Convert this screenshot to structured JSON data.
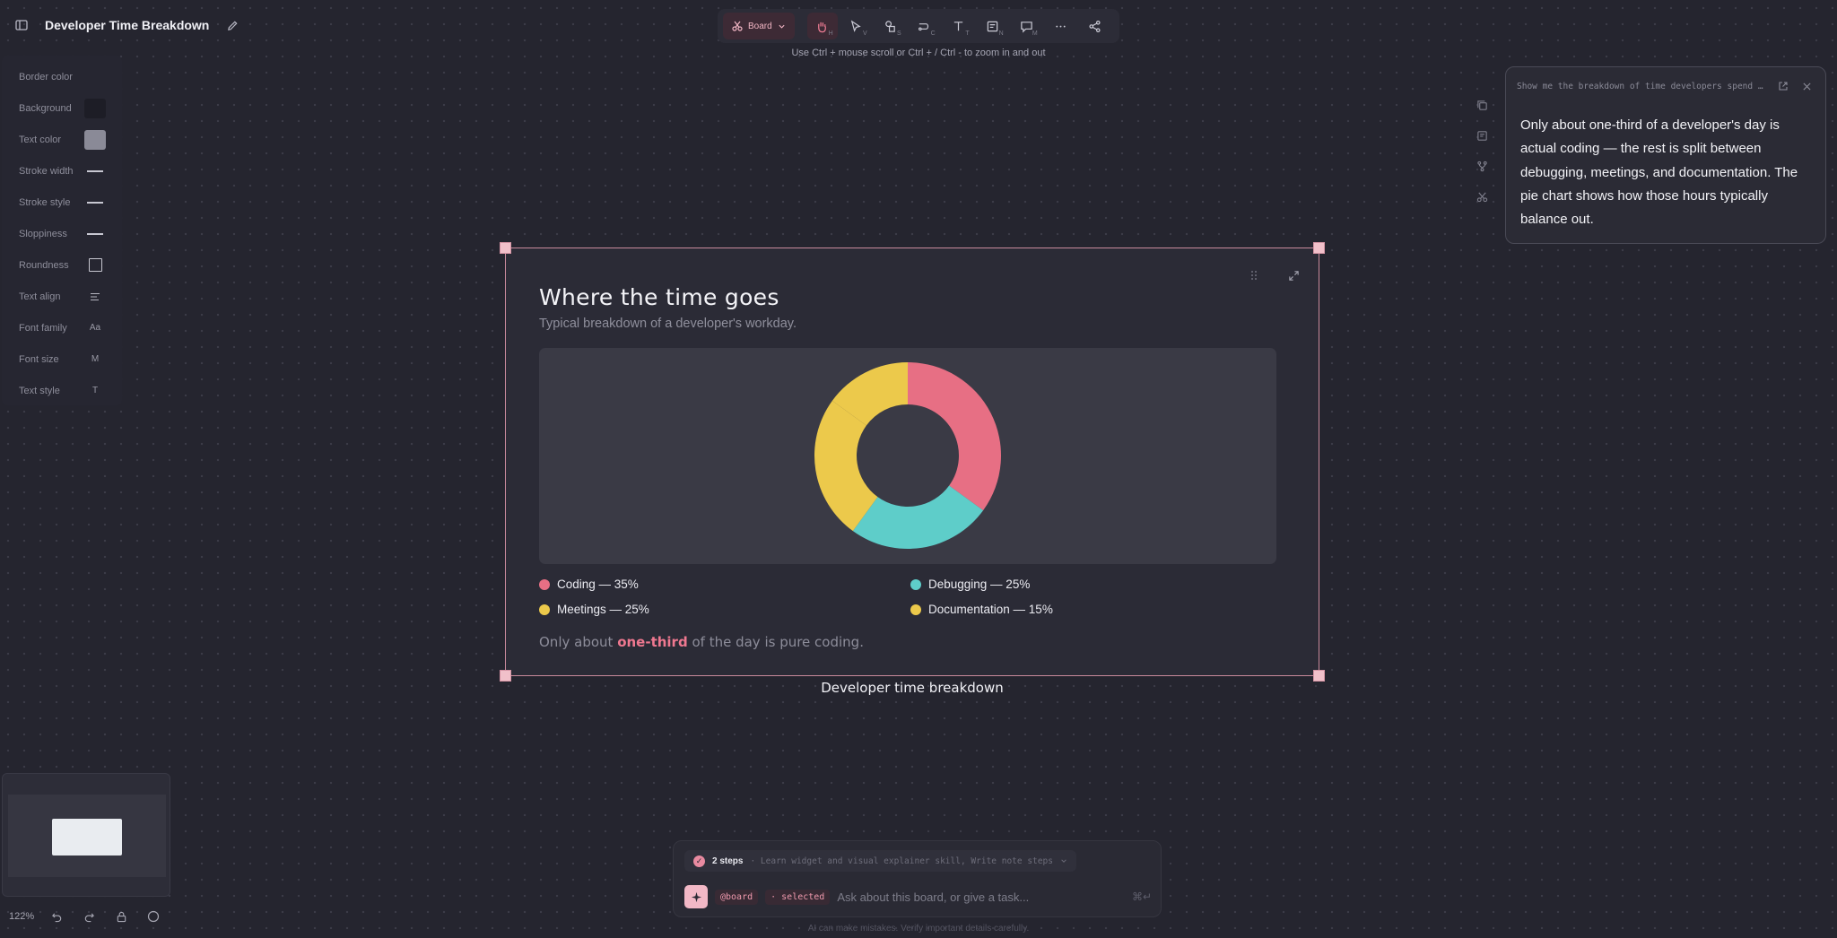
{
  "app": {
    "doc_title": "Developer Time Breakdown",
    "zoom_hint": "Use Ctrl + mouse scroll or Ctrl + / Ctrl - to zoom in and out"
  },
  "toolbar": {
    "board_label": "Board",
    "tools": [
      {
        "icon": "hand-icon",
        "key": "H",
        "active": true
      },
      {
        "icon": "select-arrow-icon",
        "key": "V"
      },
      {
        "icon": "shapes-icon",
        "key": "S"
      },
      {
        "icon": "connector-icon",
        "key": "C"
      },
      {
        "icon": "text-icon",
        "key": "T"
      },
      {
        "icon": "sticky-note-icon",
        "key": "N"
      },
      {
        "icon": "comment-icon",
        "key": "M"
      },
      {
        "icon": "more-icon",
        "key": ""
      },
      {
        "icon": "share-icon",
        "key": ""
      }
    ]
  },
  "properties": {
    "rows": [
      {
        "label": "Border color",
        "control": "none"
      },
      {
        "label": "Background",
        "control": "swatch",
        "color": "#1d1d26"
      },
      {
        "label": "Text color",
        "control": "swatch",
        "color": "#8a8a97"
      },
      {
        "label": "Stroke width",
        "control": "line"
      },
      {
        "label": "Stroke style",
        "control": "line"
      },
      {
        "label": "Sloppiness",
        "control": "line"
      },
      {
        "label": "Roundness",
        "control": "square"
      },
      {
        "label": "Text align",
        "control": "align"
      },
      {
        "label": "Font family",
        "control": "text",
        "value": "Aa"
      },
      {
        "label": "Font size",
        "control": "text",
        "value": "M"
      },
      {
        "label": "Text style",
        "control": "text",
        "value": "T"
      }
    ]
  },
  "note": {
    "query": "Show me the breakdown of time developers spend …",
    "body": "Only about one-third of a developer's day is actual coding — the rest is split between debugging, meetings, and documentation. The pie chart shows how those hours typically balance out."
  },
  "widget": {
    "title": "Where the time goes",
    "subtitle": "Typical breakdown of a developer's workday.",
    "footer_prefix": "Only about ",
    "footer_highlight": "one-third",
    "footer_suffix": " of the day is pure coding.",
    "caption": "Developer time breakdown",
    "legend": [
      {
        "label": "Coding — 35%",
        "color": "#e76f84"
      },
      {
        "label": "Debugging — 25%",
        "color": "#5ecdc9"
      },
      {
        "label": "Meetings — 25%",
        "color": "#ecc94b"
      },
      {
        "label": "Documentation — 15%",
        "color": "#ecc94b"
      }
    ]
  },
  "chart_data": {
    "type": "pie",
    "title": "Where the time goes",
    "subtitle": "Typical breakdown of a developer's workday.",
    "slices": [
      {
        "label": "Coding",
        "value": 35,
        "color": "#e76f84"
      },
      {
        "label": "Debugging",
        "value": 25,
        "color": "#5ecdc9"
      },
      {
        "label": "Meetings",
        "value": 25,
        "color": "#ecc94b"
      },
      {
        "label": "Documentation",
        "value": 15,
        "color": "#ecc94b"
      }
    ],
    "donut": true
  },
  "bottom": {
    "zoom_level": "122%"
  },
  "chat": {
    "steps_count": "2 steps",
    "steps_desc": "· Learn widget and visual explainer skill, Write note steps",
    "chip_board": "@board",
    "chip_selected": "· selected",
    "placeholder": "Ask about this board, or give a task...",
    "disclaimer": "AI can make mistakes. Verify important details carefully."
  }
}
